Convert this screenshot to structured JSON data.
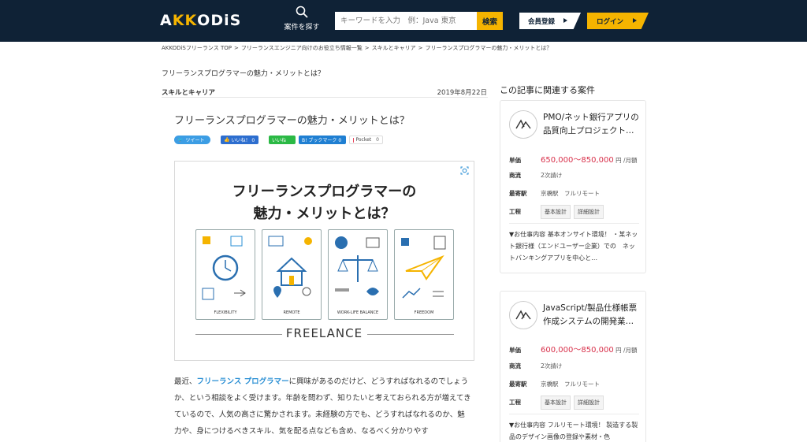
{
  "header": {
    "logo_prefix": "A",
    "logo_k": "KK",
    "logo_suffix": "ODiS",
    "search_label": "案件を探す",
    "search_placeholder": "キーワードを入力　例：Java 東京",
    "search_button": "検索",
    "register_label": "会員登録",
    "login_label": "ログイン",
    "colors": {
      "navy": "#0f2236",
      "accent": "#f5b400"
    }
  },
  "breadcrumb": {
    "items": [
      "AKKODiSフリーランス TOP",
      "フリーランスエンジニア向けのお役立ち情報一覧",
      "スキルとキャリア",
      "フリーランスプログラマーの魅力・メリットとは？"
    ],
    "separator": ">"
  },
  "page_heading": "フリーランスプログラマーの魅力・メリットとは？",
  "article": {
    "category": "スキルとキャリア",
    "date": "2019年8月22日",
    "title": "フリーランスプログラマーの魅力・メリットとは？",
    "share": {
      "tweet": "ツイート",
      "like": "いいね！ 0",
      "line": "いいね",
      "hatena": "B! ブックマーク 0",
      "pocket": "Pocket",
      "pocket_count": "0"
    },
    "hero": {
      "title_line1": "フリーランスプログラマーの",
      "title_line2": "魅力・メリットとは？",
      "panels": [
        "FLEXIBILITY",
        "REMOTE",
        "WORK-LIFE BALANCE",
        "FREEDOM"
      ],
      "footer": "FREELANCE"
    },
    "body": {
      "prefix": "最近、",
      "link": "フリーランス プログラマー",
      "text": "に興味があるのだけど、どうすればなれるのでしょうか、という相談をよく受けます。年齢を問わず、知りたいと考えておられる方が増えてきているので、人気の高さに驚かされます。未経験の方でも、どうすればなれるのか、魅力や、身につけるべきスキル、気を配る点なども含め、なるべく分かりやす"
    }
  },
  "sidebar": {
    "title": "この記事に関連する案件",
    "jobs": [
      {
        "title": "PMO/ネット銀行アプリの品質向上プロジェクト…",
        "price_label": "単価",
        "price": "650,000～850,000",
        "price_unit": "円 /月額",
        "business_label": "商流",
        "business": "2次請け",
        "station_label": "最寄駅",
        "station": "京橋駅　フルリモート",
        "process_label": "工程",
        "tags": [
          "基本設計",
          "詳細設計"
        ],
        "description": "▼お仕事内容 基本オンサイト環境！ ・某ネット銀行様（エンドユーザー企業）での　ネットバンキングアプリを中心と…"
      },
      {
        "title": "JavaScript/製品仕様帳票作成システムの開発業…",
        "price_label": "単価",
        "price": "600,000～850,000",
        "price_unit": "円 /月額",
        "business_label": "商流",
        "business": "2次請け",
        "station_label": "最寄駅",
        "station": "京橋駅　フルリモート",
        "process_label": "工程",
        "tags": [
          "基本設計",
          "詳細設計"
        ],
        "description": "▼お仕事内容 フルリモート環境！ 製造する製品のデザイン画像の登録や素材・色"
      }
    ]
  }
}
